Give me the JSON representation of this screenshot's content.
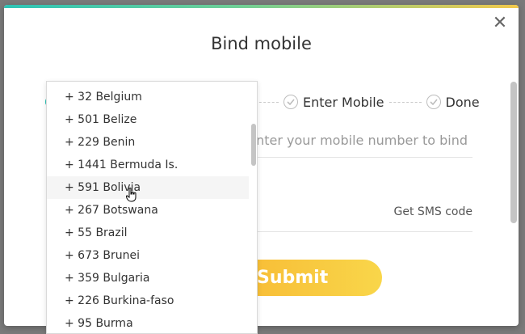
{
  "modal": {
    "title": "Bind mobile",
    "close_icon": "close-icon"
  },
  "steps": [
    {
      "label": "Enter Mobile"
    },
    {
      "label": "Done"
    }
  ],
  "form": {
    "mobile_placeholder": "Enter your mobile number to bind",
    "sms_button": "Get SMS code",
    "submit_label": "Submit"
  },
  "country_dropdown": {
    "items": [
      {
        "label": "+ 32 Belgium"
      },
      {
        "label": "+ 501 Belize"
      },
      {
        "label": "+ 229 Benin"
      },
      {
        "label": "+ 1441 Bermuda Is."
      },
      {
        "label": "+ 591 Bolivia"
      },
      {
        "label": "+ 267 Botswana"
      },
      {
        "label": "+ 55 Brazil"
      },
      {
        "label": "+ 673 Brunei"
      },
      {
        "label": "+ 359 Bulgaria"
      },
      {
        "label": "+ 226 Burkina-faso"
      },
      {
        "label": "+ 95 Burma"
      }
    ],
    "hovered_index": 4
  },
  "colors": {
    "accent_teal": "#2ec4b6",
    "submit_yellow": "#f9d64a"
  }
}
